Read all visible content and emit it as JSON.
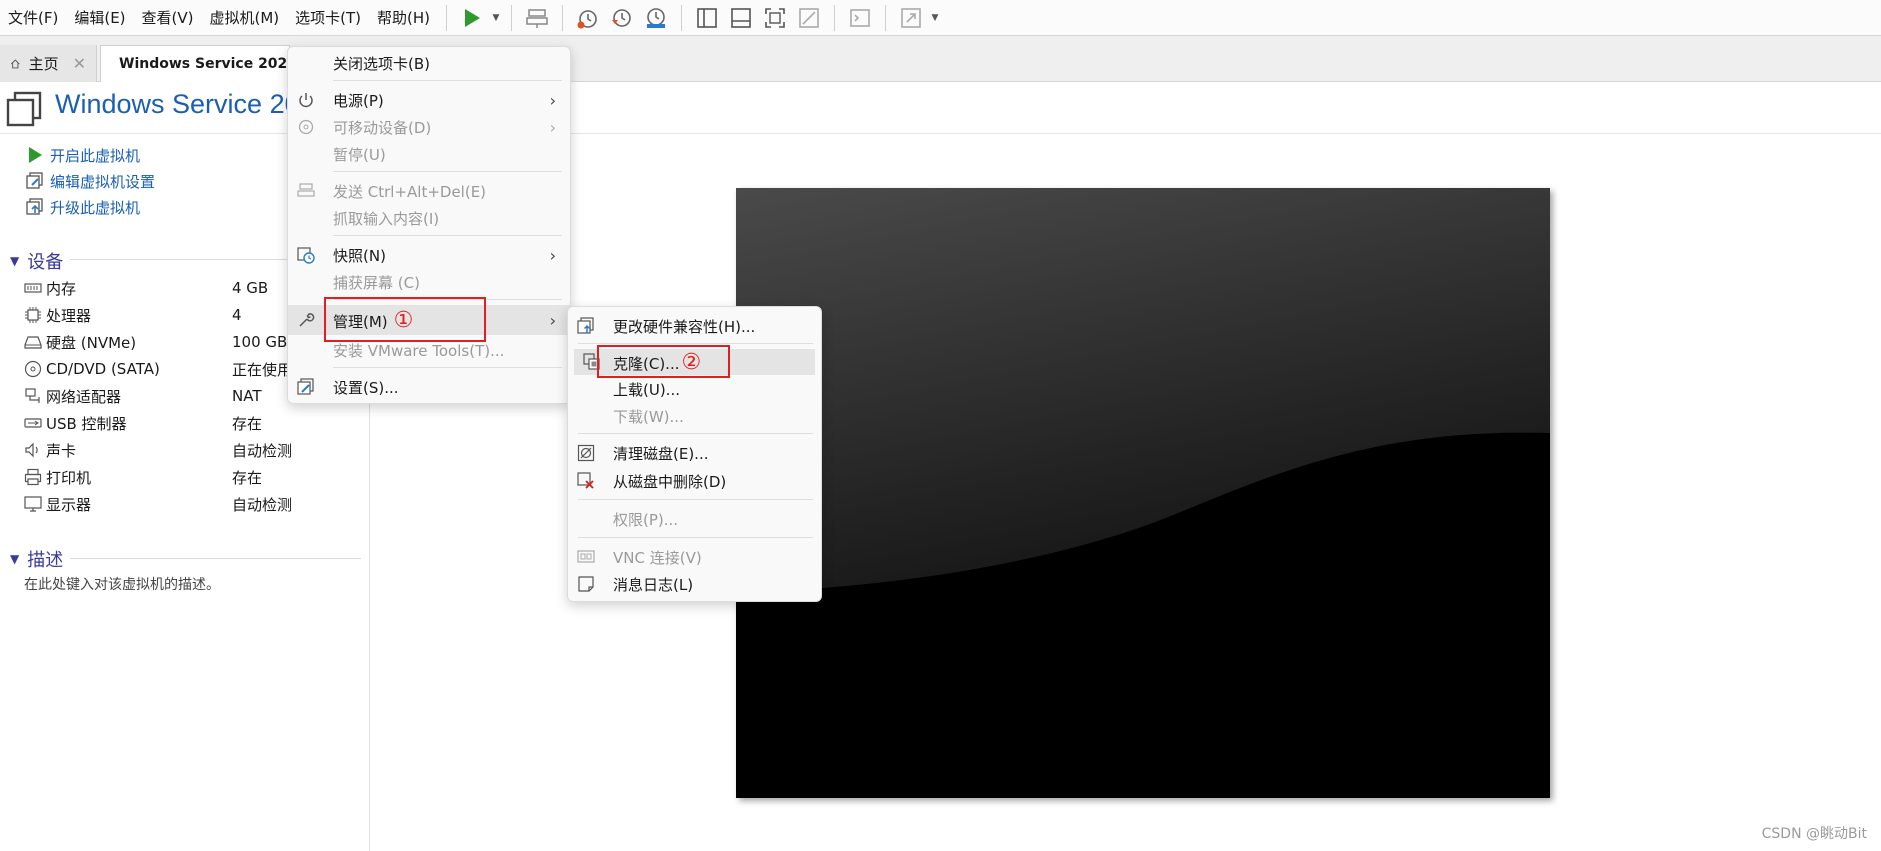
{
  "menubar": {
    "items": [
      "文件(F)",
      "编辑(E)",
      "查看(V)",
      "虚拟机(M)",
      "选项卡(T)",
      "帮助(H)"
    ]
  },
  "toolbar": {
    "icons": [
      "play-icon",
      "send-ctrl-alt-del-icon",
      "snapshot-take-icon",
      "snapshot-revert-icon",
      "snapshot-manager-icon",
      "show-library-icon",
      "thumbnail-bar-icon",
      "full-screen-icon",
      "unity-icon",
      "console-view-icon",
      "stretch-guest-icon"
    ]
  },
  "tabs": [
    {
      "label": "主页",
      "icon": "home-icon"
    },
    {
      "label": "Windows Service 2022 E",
      "icon": "vm-tab-icon"
    }
  ],
  "vm_title": "Windows Service 202",
  "actions": [
    {
      "label": "开启此虚拟机",
      "icon": "play-icon"
    },
    {
      "label": "编辑虚拟机设置",
      "icon": "edit-settings-icon"
    },
    {
      "label": "升级此虚拟机",
      "icon": "upgrade-icon"
    }
  ],
  "devices_section": {
    "title": "设备",
    "rows": [
      {
        "name": "内存",
        "value": "4 GB",
        "icon": "memory-icon"
      },
      {
        "name": "处理器",
        "value": "4",
        "icon": "cpu-icon"
      },
      {
        "name": "硬盘 (NVMe)",
        "value": "100 GB",
        "icon": "hard-disk-icon"
      },
      {
        "name": "CD/DVD (SATA)",
        "value": "正在使用",
        "icon": "cd-dvd-icon"
      },
      {
        "name": "网络适配器",
        "value": "NAT",
        "icon": "network-icon"
      },
      {
        "name": "USB 控制器",
        "value": "存在",
        "icon": "usb-icon"
      },
      {
        "name": "声卡",
        "value": "自动检测",
        "icon": "sound-icon"
      },
      {
        "name": "打印机",
        "value": "存在",
        "icon": "printer-icon"
      },
      {
        "name": "显示器",
        "value": "自动检测",
        "icon": "display-icon"
      }
    ]
  },
  "description_section": {
    "title": "描述",
    "placeholder": "在此处键入对该虚拟机的描述。"
  },
  "vm_menu": {
    "items": [
      {
        "label": "关闭选项卡(B)",
        "enabled": true
      },
      {
        "label": "电源(P)",
        "enabled": true,
        "submenu": true,
        "icon": "power-icon"
      },
      {
        "label": "可移动设备(D)",
        "enabled": false,
        "submenu": true,
        "icon": "removable-devices-icon"
      },
      {
        "label": "暂停(U)",
        "enabled": false
      },
      {
        "label": "发送 Ctrl+Alt+Del(E)",
        "enabled": false,
        "icon": "send-keys-icon"
      },
      {
        "label": "抓取输入内容(I)",
        "enabled": false
      },
      {
        "label": "快照(N)",
        "enabled": true,
        "submenu": true,
        "icon": "snapshot-icon"
      },
      {
        "label": "捕获屏幕 (C)",
        "enabled": false
      },
      {
        "label": "管理(M)",
        "enabled": true,
        "submenu": true,
        "highlighted": true,
        "icon": "wrench-icon",
        "marker": "①"
      },
      {
        "label": "安装 VMware Tools(T)...",
        "enabled": false
      },
      {
        "label": "设置(S)...",
        "enabled": true,
        "icon": "settings-icon"
      }
    ]
  },
  "manage_menu": {
    "items": [
      {
        "label": "更改硬件兼容性(H)...",
        "enabled": true,
        "icon": "hardware-compat-icon"
      },
      {
        "label": "克隆(C)...",
        "enabled": true,
        "highlighted": true,
        "icon": "clone-icon",
        "marker": "②"
      },
      {
        "label": "上载(U)...",
        "enabled": true
      },
      {
        "label": "下载(W)...",
        "enabled": false
      },
      {
        "label": "清理磁盘(E)...",
        "enabled": true,
        "icon": "clean-disk-icon"
      },
      {
        "label": "从磁盘中删除(D)",
        "enabled": true,
        "icon": "delete-from-disk-icon"
      },
      {
        "label": "权限(P)...",
        "enabled": false
      },
      {
        "label": "VNC 连接(V)",
        "enabled": false,
        "icon": "vnc-icon"
      },
      {
        "label": "消息日志(L)",
        "enabled": true,
        "icon": "message-log-icon"
      }
    ]
  },
  "watermark": "CSDN @眺动Bit",
  "colors": {
    "link_blue": "#1a5fb4",
    "section_title": "#3a3a9a",
    "annotation_red": "#e02020",
    "play_green": "#2e9a2e"
  }
}
